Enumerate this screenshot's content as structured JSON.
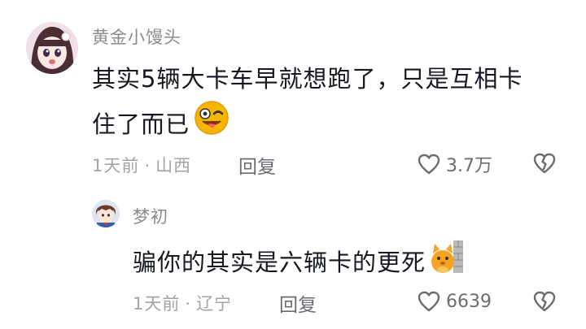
{
  "comments": [
    {
      "username": "黄金小馒头",
      "text_line1": "其实5辆大卡车早就想跑了，只是互相卡",
      "text_line2": "住了而已",
      "emoji": "wink-tongue-emoji",
      "time": "1天前",
      "location": "山西",
      "reply_label": "回复",
      "likes": "3.7万"
    },
    {
      "username": "梦初",
      "text": "骗你的其实是六辆卡的更死",
      "emoji": "cat-wall-emoji",
      "time": "1天前",
      "location": "辽宁",
      "reply_label": "回复",
      "likes": "6639"
    }
  ],
  "separator": "·",
  "icons": {
    "like": "heart-outline-icon",
    "dislike": "broken-heart-icon"
  },
  "colors": {
    "text_primary": "#161823",
    "text_secondary": "#8a8b91",
    "icon_gray": "#6b6c72",
    "emoji_yellow": "#f7b500"
  }
}
